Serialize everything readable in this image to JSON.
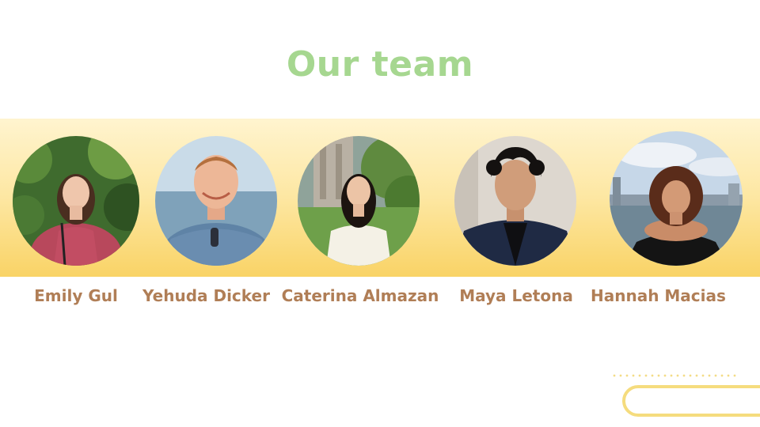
{
  "slide": {
    "title": "Our team"
  },
  "team": [
    {
      "name": "Emily Gul"
    },
    {
      "name": "Yehuda Dicker"
    },
    {
      "name": "Caterina Almazan"
    },
    {
      "name": "Maya Letona"
    },
    {
      "name": "Hannah Macias"
    }
  ],
  "colors": {
    "title": "#a6d790",
    "name": "#b07e56",
    "band_top": "#fff4cf",
    "band_bottom": "#f9d366",
    "accent": "#f5dc7e"
  }
}
